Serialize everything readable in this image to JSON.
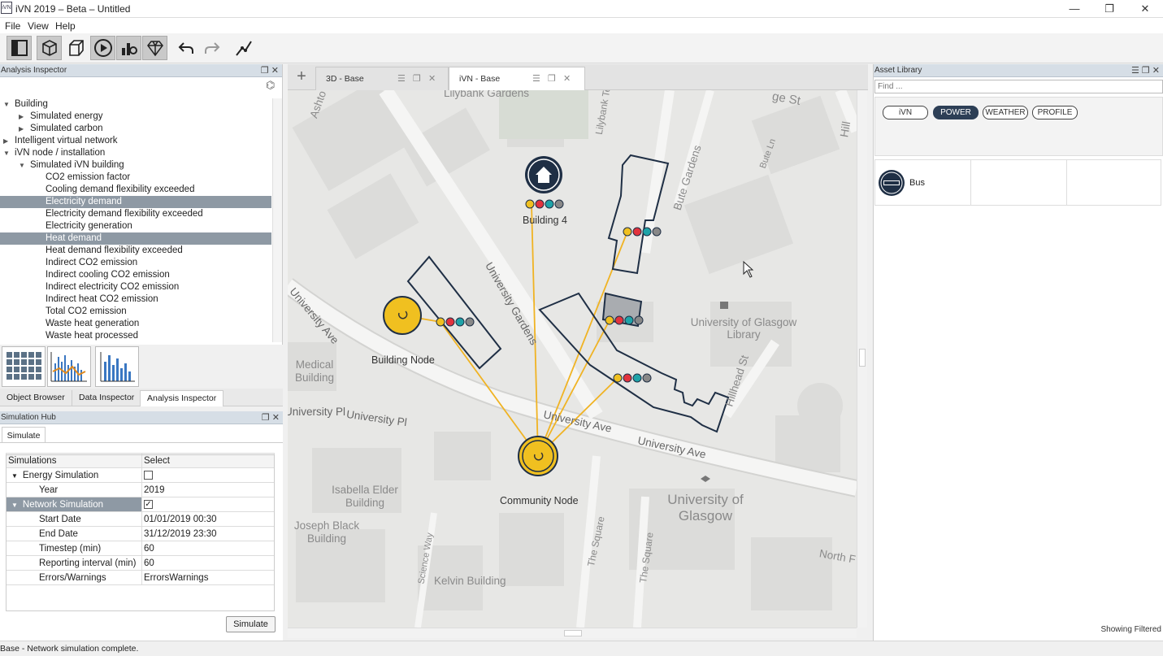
{
  "window": {
    "title": "iVN 2019 – Beta – Untitled",
    "app_icon_text": "iVN",
    "minimize": "—",
    "restore": "❐",
    "close": "✕"
  },
  "menu": [
    "File",
    "View",
    "Help"
  ],
  "toolbar": {
    "icons": [
      "panel-icon",
      "3d-box-icon",
      "box-outline-icon",
      "play-icon",
      "analysis-icon",
      "gem-icon",
      "undo-icon",
      "redo-icon",
      "network-icon"
    ]
  },
  "analysis_inspector": {
    "title": "Analysis Inspector",
    "tree": [
      {
        "label": "Building",
        "level": 0,
        "expanded": true
      },
      {
        "label": "Simulated energy",
        "level": 1,
        "expanded": false
      },
      {
        "label": "Simulated carbon",
        "level": 1,
        "expanded": false
      },
      {
        "label": "Intelligent virtual network",
        "level": 0,
        "expanded": false
      },
      {
        "label": "iVN node / installation",
        "level": 0,
        "expanded": true
      },
      {
        "label": "Simulated iVN building",
        "level": 1,
        "expanded": true
      },
      {
        "label": "CO2 emission factor",
        "level": 2
      },
      {
        "label": "Cooling demand flexibility exceeded",
        "level": 2
      },
      {
        "label": "Electricity demand",
        "level": 2,
        "selected": true
      },
      {
        "label": "Electricity demand flexibility exceeded",
        "level": 2
      },
      {
        "label": "Electricity generation",
        "level": 2
      },
      {
        "label": "Heat demand",
        "level": 2,
        "selected": true
      },
      {
        "label": "Heat demand flexibility exceeded",
        "level": 2
      },
      {
        "label": "Indirect CO2 emission",
        "level": 2
      },
      {
        "label": "Indirect cooling CO2 emission",
        "level": 2
      },
      {
        "label": "Indirect electricity CO2 emission",
        "level": 2
      },
      {
        "label": "Indirect heat CO2 emission",
        "level": 2
      },
      {
        "label": "Total CO2 emission",
        "level": 2
      },
      {
        "label": "Waste heat generation",
        "level": 2
      },
      {
        "label": "Waste heat processed",
        "level": 2
      }
    ]
  },
  "left_tabs": [
    "Object Browser",
    "Data Inspector",
    "Analysis Inspector"
  ],
  "simulation_hub": {
    "title": "Simulation Hub",
    "tab": "Simulate",
    "headers": [
      "Simulations",
      "Select"
    ],
    "rows": [
      {
        "label": "Energy Simulation",
        "value": "",
        "checkbox": false,
        "group": true
      },
      {
        "label": "Year",
        "value": "2019"
      },
      {
        "label": "Network Simulation",
        "value": "",
        "checkbox": true,
        "group": true,
        "selected": true
      },
      {
        "label": "Start Date",
        "value": "01/01/2019 00:30"
      },
      {
        "label": "End Date",
        "value": "31/12/2019 23:30"
      },
      {
        "label": "Timestep (min)",
        "value": "60"
      },
      {
        "label": "Reporting interval (min)",
        "value": "60"
      },
      {
        "label": "Errors/Warnings",
        "value": "ErrorsWarnings"
      }
    ],
    "button": "Simulate"
  },
  "status": "Base - Network simulation complete.",
  "center_tabs": [
    {
      "label": "3D - Base",
      "active": false
    },
    {
      "label": "iVN - Base",
      "active": true
    }
  ],
  "plus_label": "+",
  "map": {
    "street_labels": [
      "Lilybank Gardens",
      "Lilybank Te",
      "ge St",
      "Bute Gardens",
      "Bute Ln",
      "University Gardens",
      "University Ave",
      "University Pl",
      "University Pl",
      "University Ave",
      "University Ave",
      "Hillhead St",
      "University of Glasgow Library",
      "Medical Building",
      "Isabella Elder Building",
      "Joseph Black Building",
      "Kelvin Building",
      "University of Glasgow",
      "The Square",
      "The Square",
      "Science Way",
      "North F",
      "Ashto",
      "Hill"
    ],
    "nodes": [
      {
        "name": "Building 4"
      },
      {
        "name": "Building Node"
      },
      {
        "name": "Community Node"
      }
    ],
    "colors": {
      "line": "#f0b323",
      "shape": "#1f2f45",
      "yellow": "#f0c020",
      "red": "#e2333d",
      "teal": "#1fa3a8",
      "gray": "#888888"
    }
  },
  "asset_library": {
    "title": "Asset Library",
    "find_placeholder": "Find ...",
    "filters": [
      {
        "label": "iVN",
        "active": false
      },
      {
        "label": "POWER",
        "active": true
      },
      {
        "label": "WEATHER",
        "active": false
      },
      {
        "label": "PROFILE",
        "active": false
      }
    ],
    "items": [
      {
        "label": "Bus"
      }
    ],
    "footer": "Showing Filtered"
  }
}
